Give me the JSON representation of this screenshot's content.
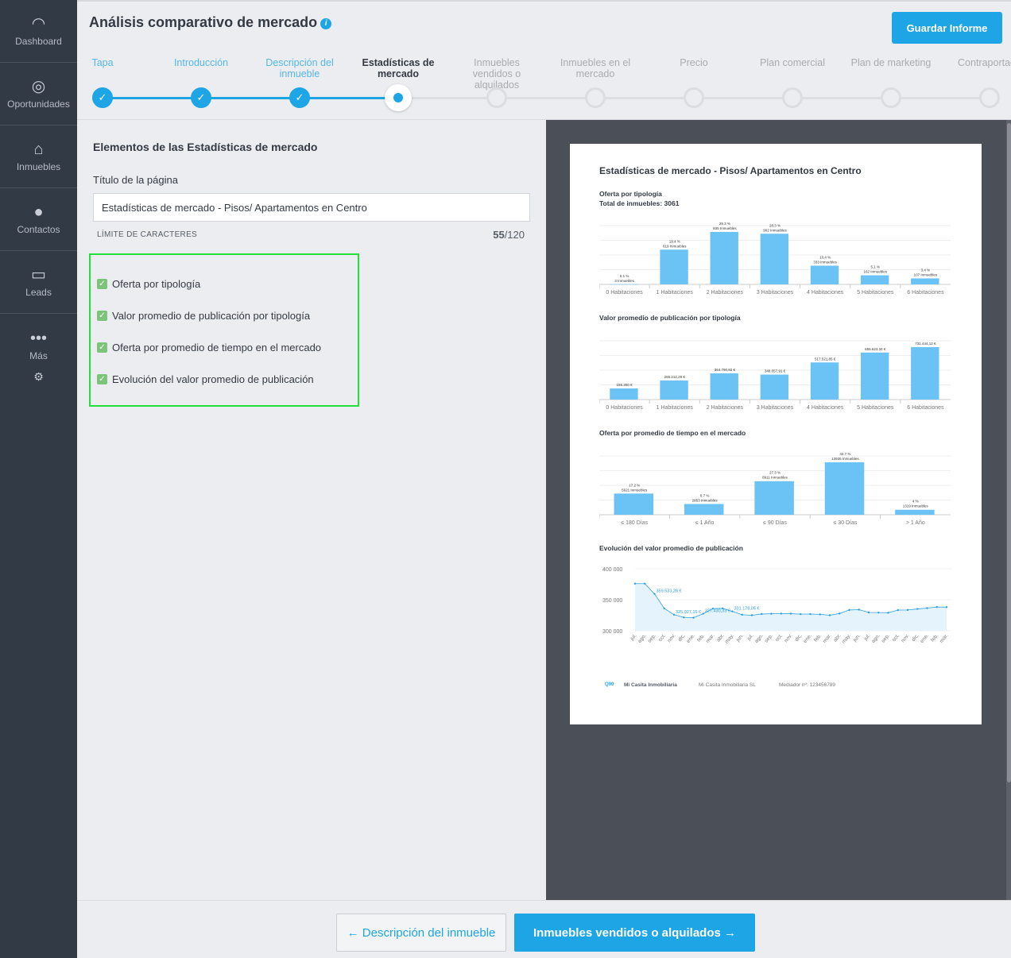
{
  "sidebar": {
    "items": [
      {
        "label": "Dashboard",
        "icon": "gauge-icon"
      },
      {
        "label": "Oportunidades",
        "icon": "target-icon"
      },
      {
        "label": "Inmuebles",
        "icon": "house-icon"
      },
      {
        "label": "Contactos",
        "icon": "user-icon"
      },
      {
        "label": "Leads",
        "icon": "inbox-icon"
      },
      {
        "label": "Más",
        "icon": "dots-icon"
      }
    ],
    "settings_icon": "gear-icon"
  },
  "header": {
    "title": "Análisis comparativo de mercado",
    "save_label": "Guardar Informe",
    "steps": [
      {
        "label": "Tapa",
        "state": "done"
      },
      {
        "label": "Introducción",
        "state": "done"
      },
      {
        "label": "Descripción del inmueble",
        "state": "done"
      },
      {
        "label": "Estadísticas de mercado",
        "state": "current"
      },
      {
        "label": "Inmuebles vendidos o alquilados",
        "state": "pending"
      },
      {
        "label": "Inmuebles en el mercado",
        "state": "pending"
      },
      {
        "label": "Precio",
        "state": "pending"
      },
      {
        "label": "Plan comercial",
        "state": "pending"
      },
      {
        "label": "Plan de marketing",
        "state": "pending"
      },
      {
        "label": "Contraportada",
        "state": "pending"
      }
    ]
  },
  "form": {
    "section_title": "Elementos de las Estadísticas de mercado",
    "page_title_label": "Título de la página",
    "page_title_value": "Estadísticas de mercado - Pisos/ Apartamentos en Centro",
    "char_limit_label": "LÍMITE DE CARACTERES",
    "char_count": "55",
    "char_max": "/120",
    "options": [
      {
        "label": "Oferta por tipología",
        "checked": true
      },
      {
        "label": "Valor promedio de publicación por tipología",
        "checked": true
      },
      {
        "label": "Oferta por promedio de tiempo en el mercado",
        "checked": true
      },
      {
        "label": "Evolución del valor promedio de publicación",
        "checked": true
      }
    ]
  },
  "preview": {
    "title": "Estadísticas de mercado - Pisos/ Apartamentos en Centro",
    "footer": {
      "brand": "Mi Casita Inmobiliaria",
      "company": "Mi Casita Inmobiliaria SL",
      "mediator": "Mediador nº: 123456789"
    }
  },
  "chart_data": [
    {
      "type": "bar",
      "title": "Oferta por tipología",
      "subtitle": "Total de inmuebles: 3061",
      "categories": [
        "0 Habitaciones",
        "1 Habitaciones",
        "2 Habitaciones",
        "3 Habitaciones",
        "4 Habitaciones",
        "5 Habitaciones",
        "6 Habitaciones"
      ],
      "values": [
        3,
        619,
        935,
        902,
        333,
        162,
        107
      ],
      "percent_labels": [
        "0.1 %",
        "19.4 %",
        "29.3 %",
        "28.3 %",
        "10.4 %",
        "5.1 %",
        "3.4 %"
      ],
      "count_labels": [
        "3 Inmuebles",
        "619 Inmuebles",
        "935 Inmuebles",
        "902 Inmuebles",
        "333 Inmuebles",
        "162 Inmuebles",
        "107 Inmuebles"
      ],
      "color": "#6ac2f5",
      "grid": true
    },
    {
      "type": "bar",
      "title": "Valor promedio de publicación por tipología",
      "categories": [
        "0 Habitaciones",
        "1 Habitaciones",
        "2 Habitaciones",
        "3 Habitaciones",
        "4 Habitaciones",
        "5 Habitaciones",
        "6 Habitaciones"
      ],
      "values": [
        155300,
        266212.29,
        364790.92,
        348057.91,
        517521.85,
        655623.34,
        731444.12
      ],
      "value_labels": [
        "155.300 €",
        "266.212,29 €",
        "364.790,92 €",
        "348.057,91 €",
        "517.521,85 €",
        "655.623,34 €",
        "731.444,12 €"
      ],
      "color": "#6ac2f5",
      "grid": true
    },
    {
      "type": "bar",
      "title": "Oferta por promedio de tiempo en el mercado",
      "categories": [
        "≤ 180 Días",
        "≤ 1 Año",
        "≤ 90 Días",
        "≤ 30 Días",
        "> 1 Año"
      ],
      "values": [
        5621,
        2853,
        8911,
        13935,
        1319
      ],
      "percent_labels": [
        "17.2 %",
        "8.7 %",
        "27.3 %",
        "42.7 %",
        "4 %"
      ],
      "count_labels": [
        "5621 Inmuebles",
        "2853 Inmuebles",
        "8911 Inmuebles",
        "13935 Inmuebles",
        "1319 Inmuebles"
      ],
      "color": "#6ac2f5",
      "grid": true
    },
    {
      "type": "area",
      "title": "Evolución del valor promedio de publicación",
      "x": [
        "jul.",
        "ago.",
        "sep.",
        "oct.",
        "nov.",
        "dic.",
        "ene.",
        "feb.",
        "mar.",
        "abr.",
        "may.",
        "jun.",
        "jul.",
        "ago.",
        "sep.",
        "oct.",
        "nov.",
        "dic.",
        "ene.",
        "feb.",
        "mar.",
        "abr.",
        "may.",
        "jun.",
        "jul.",
        "ago.",
        "sep.",
        "oct.",
        "nov.",
        "dic.",
        "ene.",
        "feb.",
        "mar."
      ],
      "values": [
        376000,
        376000,
        359533.26,
        336000,
        325927.16,
        321600,
        321000,
        327430.33,
        335700,
        336000,
        331178.05,
        325800,
        325000,
        327000,
        327400,
        327600,
        327500,
        326800,
        326900,
        326400,
        325000,
        327800,
        333500,
        334000,
        329500,
        329300,
        329000,
        333300,
        333500,
        335200,
        336500,
        338300,
        338107
      ],
      "yticks": [
        "400 000",
        "350 000",
        "300 000"
      ],
      "ylim": [
        300000,
        400000
      ],
      "color": "#2a9fe0",
      "fill": "#e4f3fc",
      "annotations": [
        {
          "index": 2,
          "label": "359.533,26 €"
        },
        {
          "index": 4,
          "label": "325.927,16 €"
        },
        {
          "index": 7,
          "label": "327.430,33 €"
        },
        {
          "index": 10,
          "label": "331.178,05 €"
        }
      ]
    }
  ],
  "footer": {
    "back_label": "Descripción del inmueble",
    "next_label": "Inmuebles vendidos o alquilados"
  }
}
